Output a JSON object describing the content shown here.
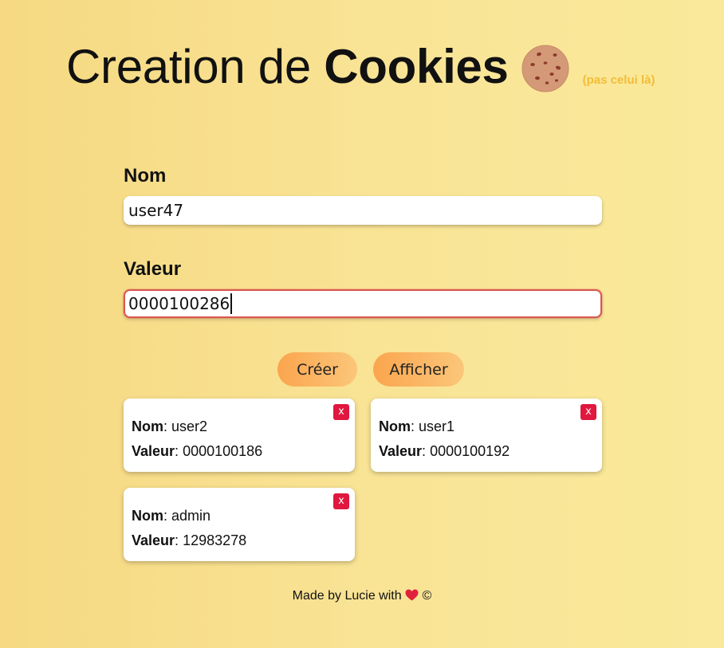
{
  "header": {
    "title_regular": "Creation de ",
    "title_bold": "Cookies",
    "subnote": "(pas celui là)",
    "icon": "cookie-icon"
  },
  "form": {
    "name_label": "Nom",
    "name_value": "user47",
    "value_label": "Valeur",
    "value_value": "0000100286"
  },
  "buttons": {
    "create_label": "Créer",
    "show_label": "Afficher"
  },
  "cookies": [
    {
      "name_key": "Nom",
      "name": "user2",
      "value_key": "Valeur",
      "value": "0000100186",
      "close_label": "x"
    },
    {
      "name_key": "Nom",
      "name": "user1",
      "value_key": "Valeur",
      "value": "0000100192",
      "close_label": "x"
    },
    {
      "name_key": "Nom",
      "name": "admin",
      "value_key": "Valeur",
      "value": "12983278",
      "close_label": "x"
    }
  ],
  "footer": {
    "text_before": "Made by Lucie with ",
    "heart_icon": "heart-icon",
    "copyright": "©"
  },
  "colors": {
    "accent_orange": "#fba54e",
    "close_red": "#e0173e",
    "subnote_yellow": "#f2bd37",
    "focus_border": "#d9574f"
  }
}
